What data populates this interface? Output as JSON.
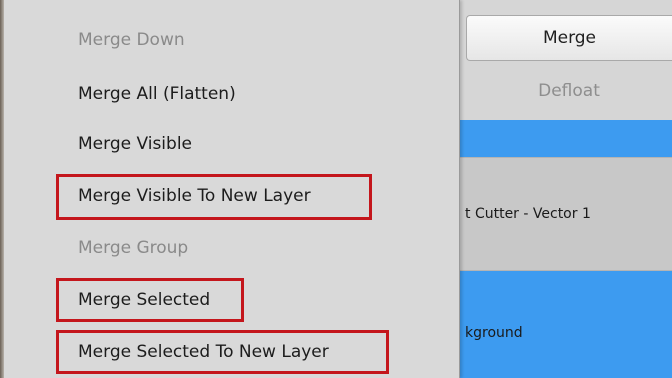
{
  "menu": {
    "items": [
      {
        "label": "Merge Down",
        "enabled": false,
        "highlighted": false
      },
      {
        "label": "Merge All (Flatten)",
        "enabled": true,
        "highlighted": false
      },
      {
        "label": "Merge Visible",
        "enabled": true,
        "highlighted": false
      },
      {
        "label": "Merge Visible To New Layer",
        "enabled": true,
        "highlighted": true
      },
      {
        "label": "Merge Group",
        "enabled": false,
        "highlighted": false
      },
      {
        "label": "Merge Selected",
        "enabled": true,
        "highlighted": true
      },
      {
        "label": "Merge Selected To New Layer",
        "enabled": true,
        "highlighted": true
      }
    ]
  },
  "panel": {
    "merge_label": "Merge",
    "defloat_label": "Defloat",
    "layers": [
      {
        "label": "t Cutter - Vector 1",
        "selected": true
      },
      {
        "label": "kground",
        "selected": false
      }
    ]
  },
  "colors": {
    "highlight_box": "#c4161c",
    "layer_blue": "#3d9bf0",
    "menu_bg": "#d9d9d9"
  }
}
